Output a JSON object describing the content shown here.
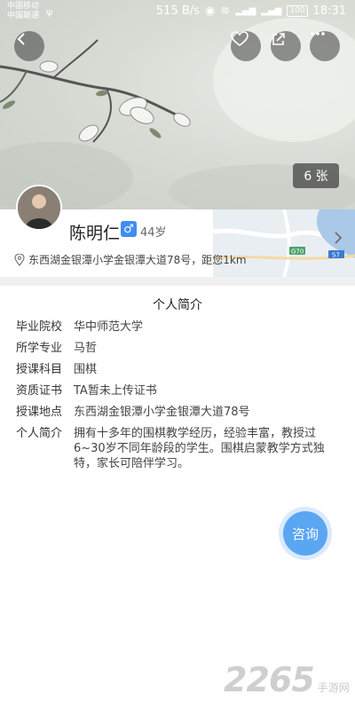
{
  "status_bar": {
    "carrier_1": "中国移动",
    "carrier_2": "中国联通",
    "speed": "515 B/s",
    "battery": "100",
    "time": "18:31"
  },
  "hero": {
    "photo_count": "6 张",
    "icons": [
      "back-icon",
      "heart-icon",
      "share-icon",
      "more-icon"
    ]
  },
  "profile": {
    "name": "陈明仁",
    "gender_symbol": "♂",
    "age": "44岁",
    "location": "东西湖金银潭小学金银潭大道78号，距您1km",
    "map_labels": [
      "G70",
      "S7"
    ]
  },
  "intro": {
    "title": "个人简介",
    "rows": [
      {
        "label": "毕业院校",
        "value": "华中师范大学"
      },
      {
        "label": "所学专业",
        "value": "马哲"
      },
      {
        "label": "授课科目",
        "value": "围棋"
      },
      {
        "label": "资质证书",
        "value": "TA暂未上传证书"
      },
      {
        "label": "授课地点",
        "value": "东西湖金银潭小学金银潭大道78号"
      },
      {
        "label": "个人简介",
        "value": "拥有十多年的围棋教学经历，经验丰富，教授过6~30岁不同年龄段的学生。围棋启蒙教学方式独特，家长可陪伴学习。"
      }
    ]
  },
  "actions": {
    "consult_label": "咨询"
  },
  "watermark": {
    "number": "2265",
    "text": "手游网"
  }
}
